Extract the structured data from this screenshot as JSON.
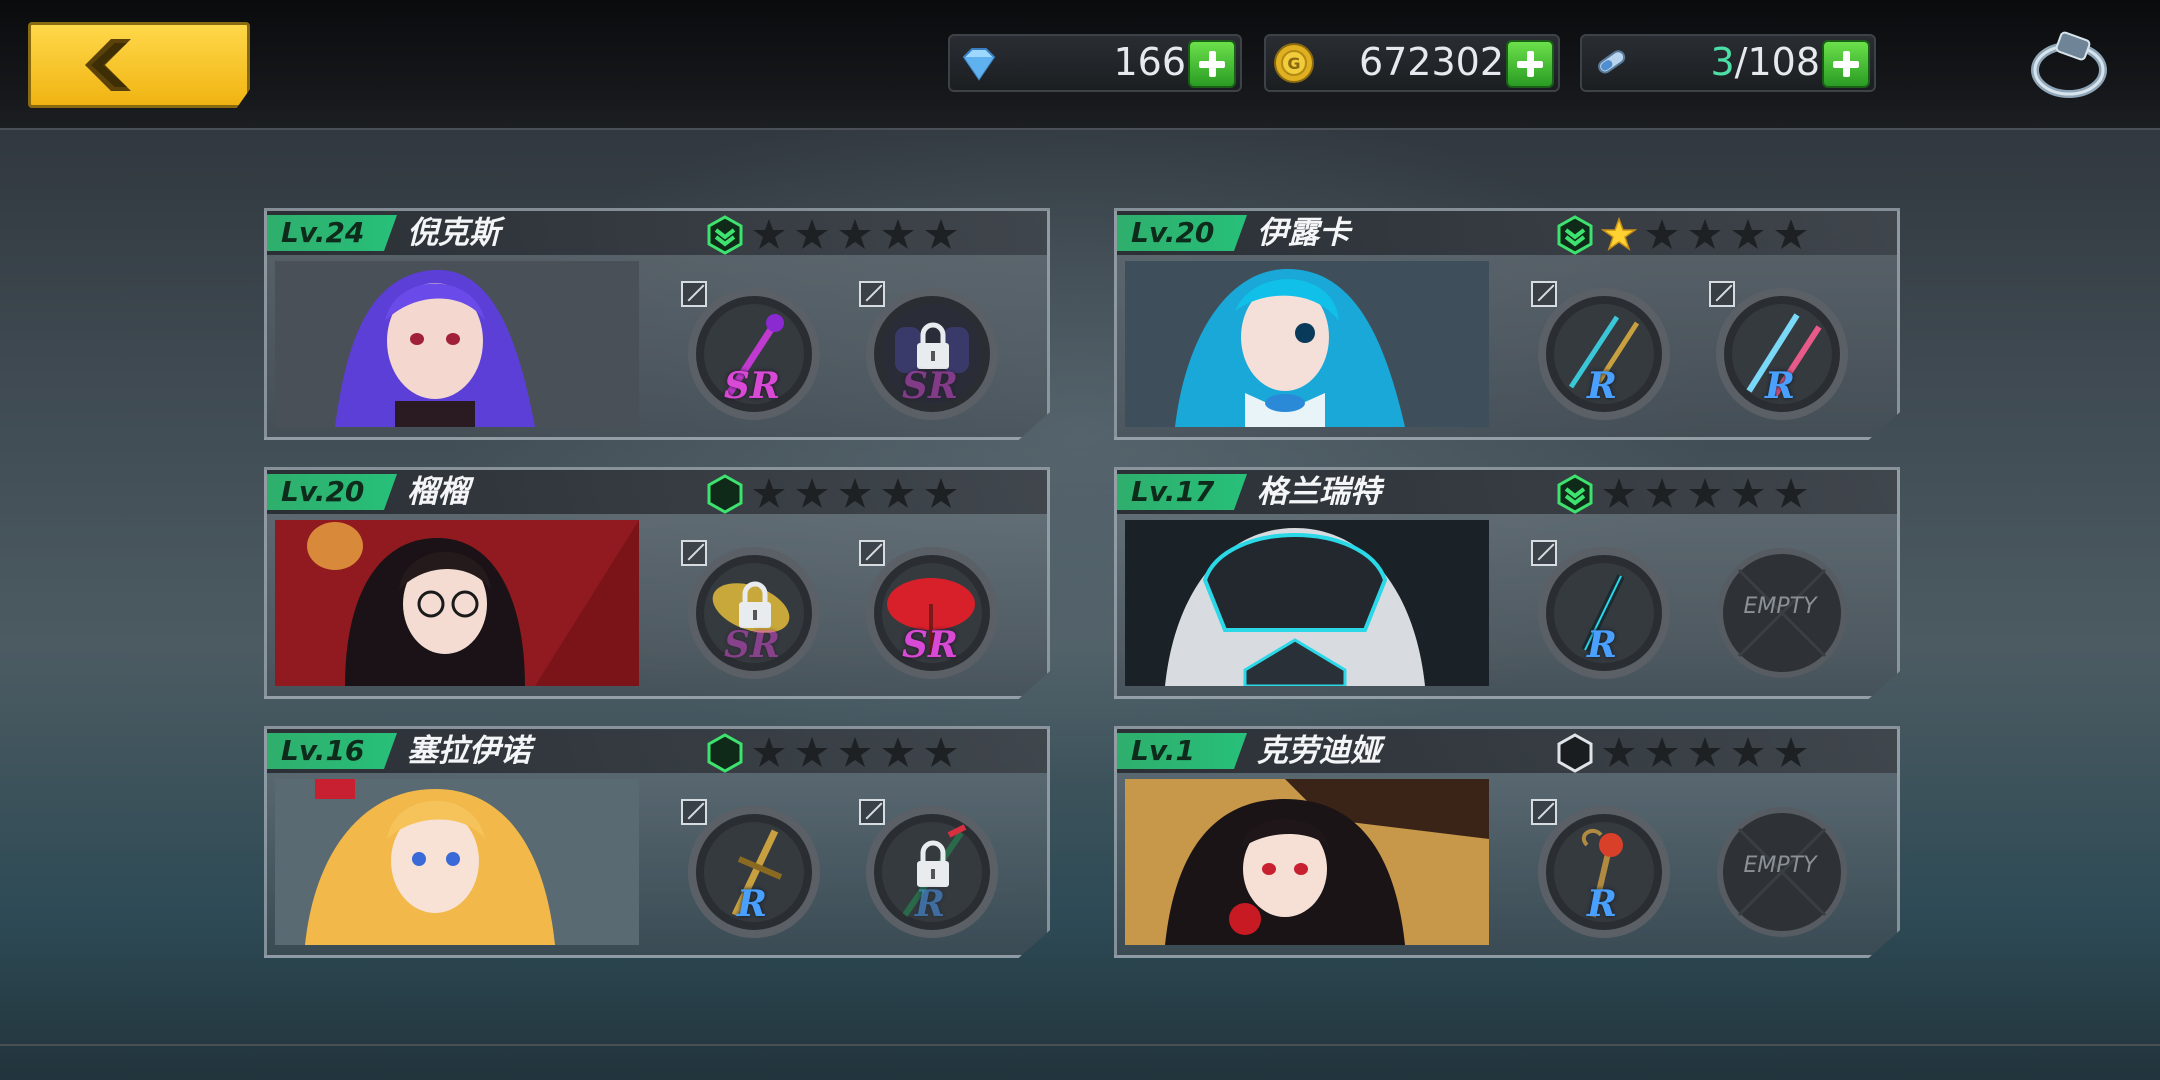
{
  "resources": {
    "gems": "166",
    "gold": "672302",
    "stamina_current": "3",
    "stamina_max": "/108"
  },
  "colors": {
    "accent": "#27c07a",
    "back": "#f0b412",
    "sr": "#d84ad6",
    "r": "#4aa0ff"
  },
  "characters": [
    {
      "level": "Lv.24",
      "name": "倪克斯",
      "rank": "green-chevron",
      "stars": 0,
      "slots": [
        {
          "grade": "SR",
          "locked": false
        },
        {
          "grade": "SR",
          "locked": true
        }
      ]
    },
    {
      "level": "Lv.20",
      "name": "伊露卡",
      "rank": "green-chevron",
      "stars": 1,
      "slots": [
        {
          "grade": "R",
          "locked": false
        },
        {
          "grade": "R",
          "locked": false
        }
      ]
    },
    {
      "level": "Lv.20",
      "name": "榴榴",
      "rank": "green-hex",
      "stars": 0,
      "slots": [
        {
          "grade": "SR",
          "locked": true
        },
        {
          "grade": "SR",
          "locked": false
        }
      ]
    },
    {
      "level": "Lv.17",
      "name": "格兰瑞特",
      "rank": "green-chevron",
      "stars": 0,
      "slots": [
        {
          "grade": "R",
          "locked": false
        },
        {
          "empty": "EMPTY"
        }
      ]
    },
    {
      "level": "Lv.16",
      "name": "塞拉伊诺",
      "rank": "green-hex",
      "stars": 0,
      "slots": [
        {
          "grade": "R",
          "locked": false
        },
        {
          "grade": "R",
          "locked": true
        }
      ]
    },
    {
      "level": "Lv.1",
      "name": "克劳迪娅",
      "rank": "white-hex",
      "stars": 0,
      "slots": [
        {
          "grade": "R",
          "locked": false
        },
        {
          "empty": "EMPTY"
        }
      ]
    }
  ]
}
